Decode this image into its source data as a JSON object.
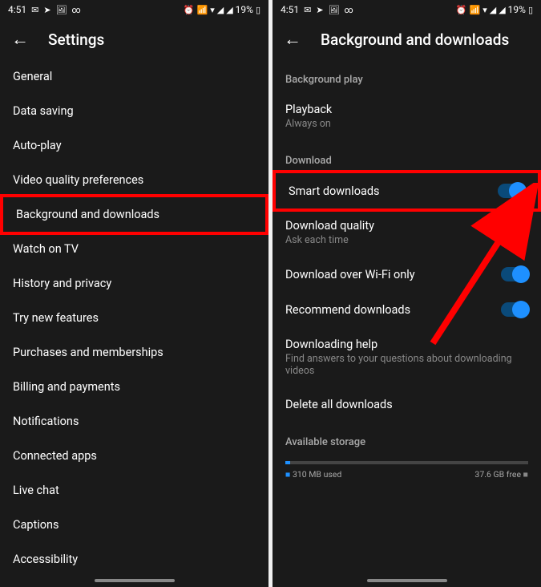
{
  "status": {
    "time": "4:51",
    "battery": "19%",
    "icons_left": [
      "✉",
      "✈",
      "🖼",
      "∞"
    ],
    "icons_right": [
      "⏰",
      "📶",
      "▾",
      "◢",
      "◢"
    ]
  },
  "left": {
    "title": "Settings",
    "items": [
      "General",
      "Data saving",
      "Auto-play",
      "Video quality preferences",
      "Background and downloads",
      "Watch on TV",
      "History and privacy",
      "Try new features",
      "Purchases and memberships",
      "Billing and payments",
      "Notifications",
      "Connected apps",
      "Live chat",
      "Captions",
      "Accessibility"
    ],
    "highlighted_index": 4
  },
  "right": {
    "title": "Background and downloads",
    "sections": {
      "background_play": {
        "header": "Background play",
        "items": [
          {
            "title": "Playback",
            "sub": "Always on"
          }
        ]
      },
      "download": {
        "header": "Download",
        "items": [
          {
            "title": "Smart downloads",
            "toggle": true,
            "highlighted": true
          },
          {
            "title": "Download quality",
            "sub": "Ask each time"
          },
          {
            "title": "Download over Wi-Fi only",
            "toggle": true
          },
          {
            "title": "Recommend downloads",
            "toggle": true
          },
          {
            "title": "Downloading help",
            "sub": "Find answers to your questions about downloading videos"
          },
          {
            "title": "Delete all downloads"
          }
        ]
      },
      "storage": {
        "header": "Available storage",
        "used": "310 MB used",
        "free": "37.6 GB free"
      }
    }
  },
  "chart_data": {
    "type": "bar",
    "title": "Available storage",
    "categories": [
      "Used",
      "Free"
    ],
    "values": [
      0.31,
      37.6
    ],
    "unit": "GB",
    "labels": [
      "310 MB used",
      "37.6 GB free"
    ]
  }
}
